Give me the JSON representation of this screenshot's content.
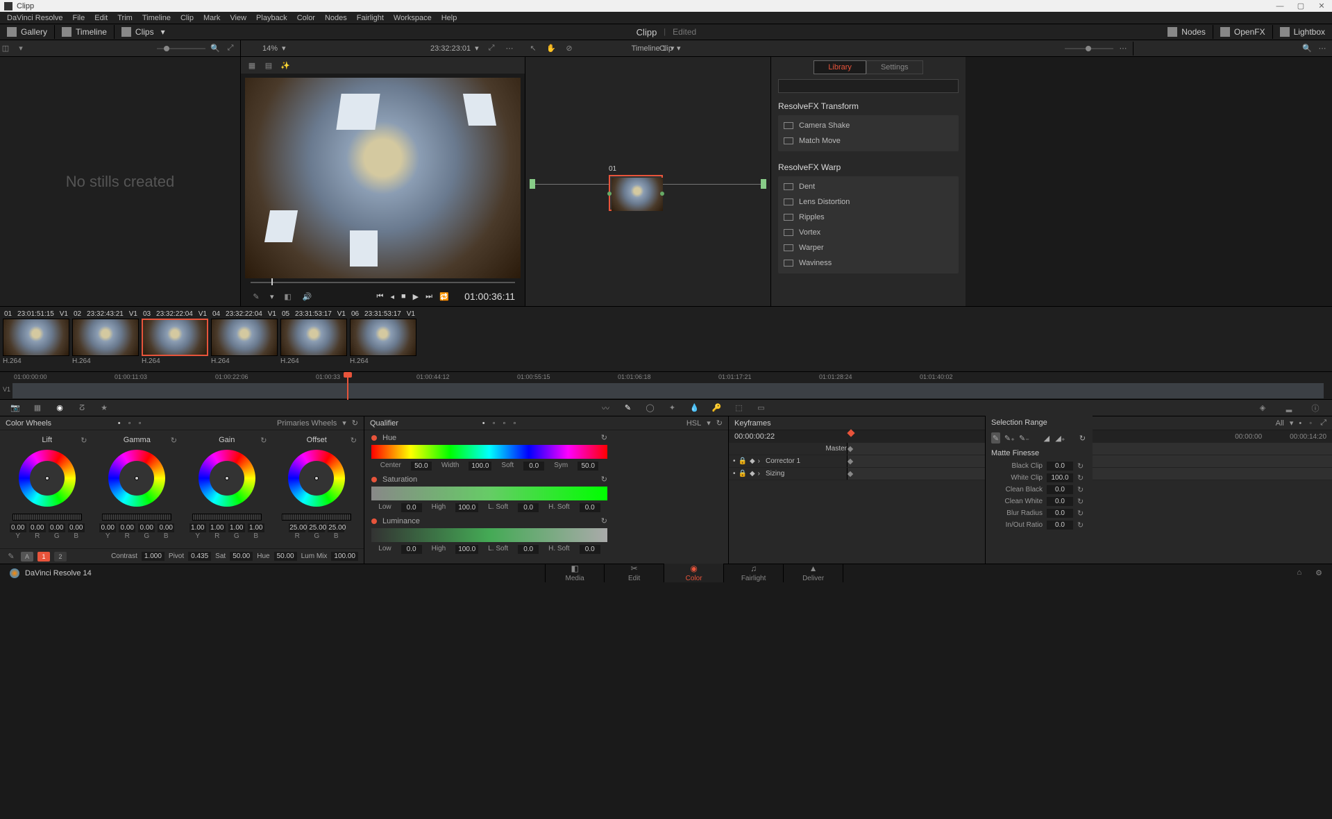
{
  "titlebar": {
    "title": "Clipp"
  },
  "menubar": [
    "DaVinci Resolve",
    "File",
    "Edit",
    "Trim",
    "Timeline",
    "Clip",
    "Mark",
    "View",
    "Playback",
    "Color",
    "Nodes",
    "Fairlight",
    "Workspace",
    "Help"
  ],
  "toolbar": {
    "gallery": "Gallery",
    "timeline": "Timeline",
    "clips": "Clips",
    "projectTitle": "Clipp",
    "projectState": "Edited",
    "nodes": "Nodes",
    "openfx": "OpenFX",
    "lightbox": "Lightbox"
  },
  "subtoolbar": {
    "zoom": "14%",
    "timelineName": "Timeline 1",
    "timelineTC": "23:32:23:01",
    "clipLabel": "Clip"
  },
  "gallery": {
    "empty": "No stills created"
  },
  "viewer": {
    "timecode": "01:00:36:11"
  },
  "nodes": {
    "nodeLabel": "01"
  },
  "fx": {
    "tabs": {
      "library": "Library",
      "settings": "Settings"
    },
    "groups": [
      {
        "title": "ResolveFX Transform",
        "items": [
          "Camera Shake",
          "Match Move"
        ]
      },
      {
        "title": "ResolveFX Warp",
        "items": [
          "Dent",
          "Lens Distortion",
          "Ripples",
          "Vortex",
          "Warper",
          "Waviness"
        ]
      }
    ]
  },
  "thumbs": [
    {
      "num": "01",
      "tc": "23:01:51:15",
      "track": "V1",
      "codec": "H.264",
      "sel": false
    },
    {
      "num": "02",
      "tc": "23:32:43:21",
      "track": "V1",
      "codec": "H.264",
      "sel": false
    },
    {
      "num": "03",
      "tc": "23:32:22:04",
      "track": "V1",
      "codec": "H.264",
      "sel": true
    },
    {
      "num": "04",
      "tc": "23:32:22:04",
      "track": "V1",
      "codec": "H.264",
      "sel": false
    },
    {
      "num": "05",
      "tc": "23:31:53:17",
      "track": "V1",
      "codec": "H.264",
      "sel": false
    },
    {
      "num": "06",
      "tc": "23:31:53:17",
      "track": "V1",
      "codec": "H.264",
      "sel": false
    }
  ],
  "timeline": {
    "trackLabel": "V1",
    "ticks": [
      "01:00:00:00",
      "01:00:11:03",
      "01:00:22:06",
      "01:00:33",
      "01:00:44:12",
      "01:00:55:15",
      "01:01:06:18",
      "01:01:17:21",
      "01:01:28:24",
      "01:01:40:02"
    ]
  },
  "wheels": {
    "title": "Color Wheels",
    "mode": "Primaries Wheels",
    "cols": [
      {
        "name": "Lift",
        "vals": [
          "0.00",
          "0.00",
          "0.00",
          "0.00"
        ]
      },
      {
        "name": "Gamma",
        "vals": [
          "0.00",
          "0.00",
          "0.00",
          "0.00"
        ]
      },
      {
        "name": "Gain",
        "vals": [
          "1.00",
          "1.00",
          "1.00",
          "1.00"
        ]
      },
      {
        "name": "Offset",
        "vals": [
          "25.00",
          "25.00",
          "25.00"
        ]
      }
    ],
    "chanLabels": [
      "Y",
      "R",
      "G",
      "B"
    ],
    "offsetLabels": [
      "R",
      "G",
      "B"
    ],
    "footer": {
      "btn1": "1",
      "btn2": "2",
      "contrast": "Contrast",
      "contrastV": "1.000",
      "pivot": "Pivot",
      "pivotV": "0.435",
      "sat": "Sat",
      "satV": "50.00",
      "hue": "Hue",
      "hueV": "50.00",
      "lummix": "Lum Mix",
      "lummixV": "100.00"
    }
  },
  "qualifier": {
    "title": "Qualifier",
    "mode": "HSL",
    "hue": {
      "label": "Hue",
      "center": "Center",
      "centerV": "50.0",
      "width": "Width",
      "widthV": "100.0",
      "soft": "Soft",
      "softV": "0.0",
      "sym": "Sym",
      "symV": "50.0"
    },
    "sat": {
      "label": "Saturation",
      "low": "Low",
      "lowV": "0.0",
      "high": "High",
      "highV": "100.0",
      "lsoft": "L. Soft",
      "lsoftV": "0.0",
      "hsoft": "H. Soft",
      "hsoftV": "0.0"
    },
    "lum": {
      "label": "Luminance",
      "low": "Low",
      "lowV": "0.0",
      "high": "High",
      "highV": "100.0",
      "lsoft": "L. Soft",
      "lsoftV": "0.0",
      "hsoft": "H. Soft",
      "hsoftV": "0.0"
    }
  },
  "matte": {
    "selRange": "Selection Range",
    "finesse": "Matte Finesse",
    "rows": [
      {
        "l": "Black Clip",
        "v": "0.0"
      },
      {
        "l": "White Clip",
        "v": "100.0"
      },
      {
        "l": "Clean Black",
        "v": "0.0"
      },
      {
        "l": "Clean White",
        "v": "0.0"
      },
      {
        "l": "Blur Radius",
        "v": "0.0"
      },
      {
        "l": "In/Out Ratio",
        "v": "0.0"
      }
    ]
  },
  "keyframes": {
    "title": "Keyframes",
    "all": "All",
    "tc": "00:00:00:22",
    "tcLeft": "00:00:00",
    "tcRight": "00:00:14:20",
    "rows": [
      "Master",
      "Corrector 1",
      "Sizing"
    ]
  },
  "footer": {
    "app": "DaVinci Resolve 14",
    "pages": [
      "Media",
      "Edit",
      "Color",
      "Fairlight",
      "Deliver"
    ],
    "icons": [
      "◧",
      "✂",
      "◉",
      "♫",
      "▲"
    ]
  }
}
